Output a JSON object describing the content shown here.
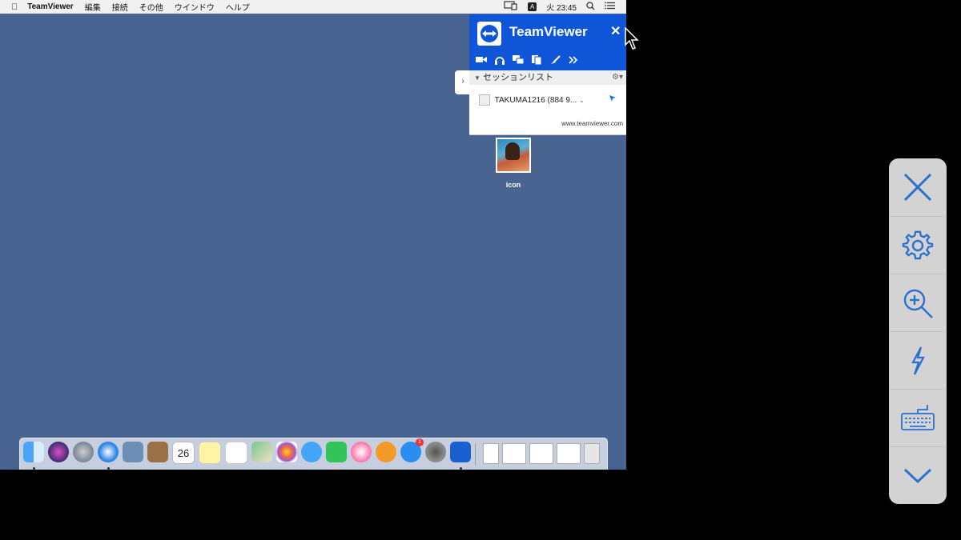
{
  "menubar": {
    "apple": "",
    "app_name": "TeamViewer",
    "menus": [
      "編集",
      "接続",
      "その他",
      "ウインドウ",
      "ヘルプ"
    ],
    "input_indicator": "A",
    "clock": "火 23:45"
  },
  "teamviewer": {
    "title": "TeamViewer",
    "close": "✕",
    "section_title": "セッションリスト",
    "session": "TAKUMA1216 (884 9...",
    "url": "www.teamviewer.com",
    "tools": [
      "video-icon",
      "headset-icon",
      "chat-icon",
      "files-icon",
      "whiteboard-icon",
      "more-icon"
    ]
  },
  "desktop": {
    "icon_label": "icon"
  },
  "dock": {
    "calendar_day": "26",
    "appstore_badge": "1",
    "apps": [
      "Finder",
      "Siri",
      "Launchpad",
      "Safari",
      "Preview",
      "Contacts",
      "Calendar",
      "Notes",
      "Reminders",
      "Maps",
      "Photos",
      "Messages",
      "FaceTime",
      "iTunes",
      "iBooks",
      "App Store",
      "System Preferences",
      "TeamViewer"
    ],
    "colors": {
      "finder": "#4aa3f5",
      "siri": "#3b2d6e",
      "launchpad": "#7b8594",
      "safari": "#2f86e6",
      "preview": "#6d8fb5",
      "contacts": "#9a7048",
      "calendar": "#ffffff",
      "notes": "#fff3a6",
      "reminders": "#ffffff",
      "maps": "#7fc48a",
      "photos": "#ffffff",
      "messages": "#42a5f5",
      "facetime": "#32c45a",
      "itunes": "#ff6fa8",
      "ibooks": "#f39a27",
      "appstore": "#2a8df0",
      "sysprefs": "#8a8a8a",
      "teamviewer": "#1a5fd0"
    }
  },
  "controls": [
    "close-icon",
    "gear-icon",
    "zoom-in-icon",
    "lightning-icon",
    "keyboard-icon",
    "chevron-down-icon"
  ],
  "accent": "#2b6fcf"
}
